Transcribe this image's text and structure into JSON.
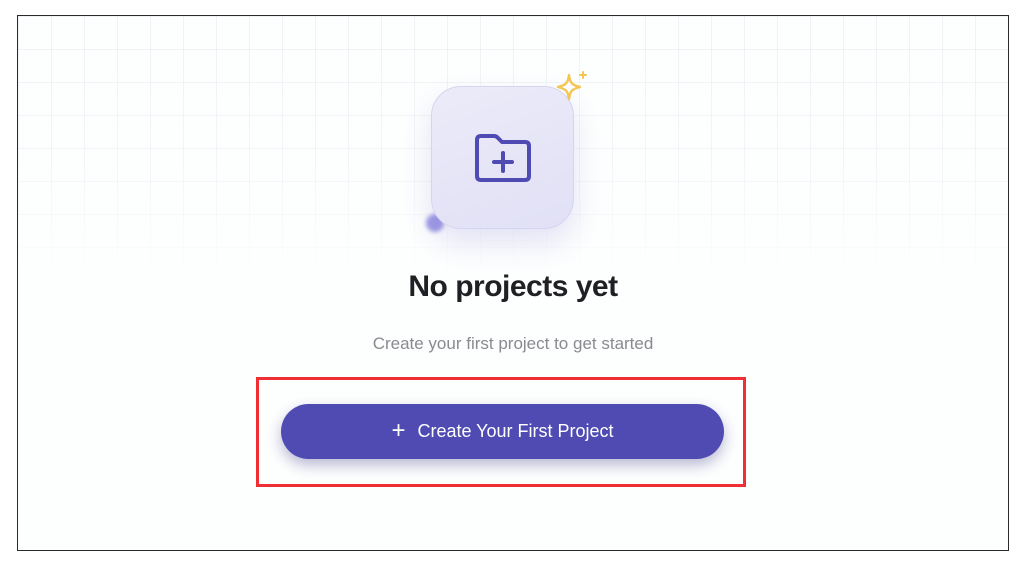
{
  "empty_state": {
    "title": "No projects yet",
    "subtitle": "Create your first project to get started",
    "cta_icon": "+",
    "cta_label": "Create Your First Project",
    "tile_icon": "folder-plus-icon",
    "sparkle_icon": "sparkle-icon"
  },
  "colors": {
    "accent": "#4f4bb3",
    "highlight": "#ef2f33",
    "sparkle": "#f4c653",
    "tile_bg": "#e6e5f7"
  }
}
